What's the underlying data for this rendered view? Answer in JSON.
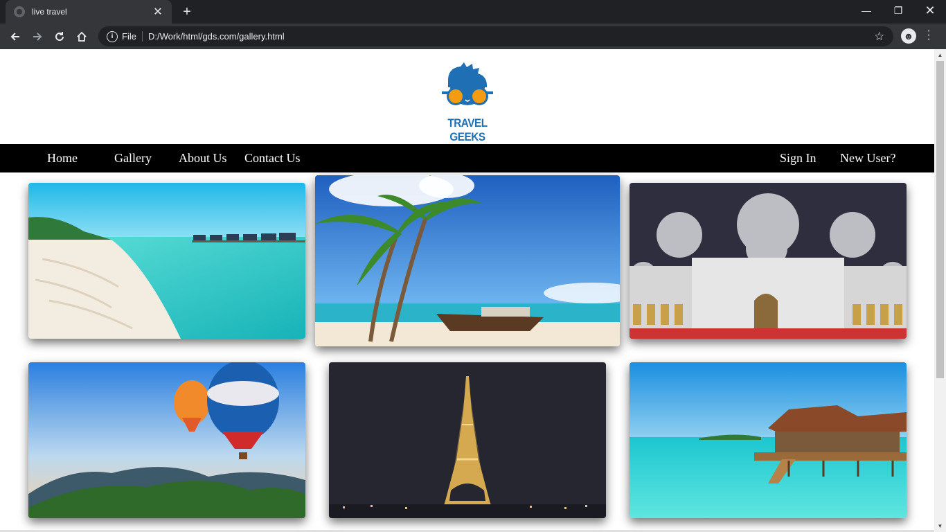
{
  "browser": {
    "tab_title": "live travel",
    "tab_close": "✕",
    "new_tab": "+",
    "scheme": "File",
    "url": "D:/Work/html/gds.com/gallery.html",
    "info_glyph": "i",
    "star_glyph": "☆",
    "window_controls": {
      "minimize": "—",
      "restore": "❐",
      "close": "✕"
    }
  },
  "site": {
    "logo_text": "TRAVEL GEEKS",
    "brand_color": "#1f6fb5",
    "accent_color": "#f39c12",
    "nav_left": [
      "Home",
      "Gallery",
      "About Us",
      "Contact Us"
    ],
    "nav_right": [
      "Sign In",
      "New User?"
    ]
  },
  "gallery": [
    {
      "subject": "maldives-beach-villas"
    },
    {
      "subject": "palm-beach-boat"
    },
    {
      "subject": "grand-mosque"
    },
    {
      "subject": "hot-air-balloons"
    },
    {
      "subject": "eiffel-tower-night"
    },
    {
      "subject": "overwater-villa"
    }
  ]
}
